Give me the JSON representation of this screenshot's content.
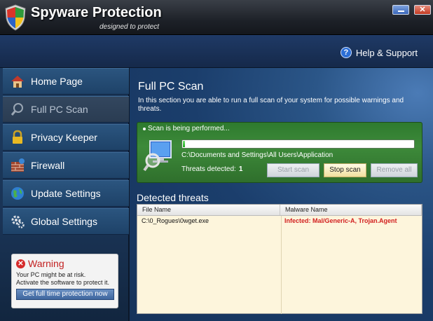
{
  "window": {
    "title": "Spyware Protection",
    "subtitle": "designed to protect"
  },
  "header": {
    "help_label": "Help & Support",
    "help_icon": "help-icon"
  },
  "sidebar": {
    "items": [
      {
        "label": "Home Page",
        "icon": "home-icon"
      },
      {
        "label": "Full PC Scan",
        "icon": "magnifier-icon",
        "active": true
      },
      {
        "label": "Privacy Keeper",
        "icon": "lock-icon"
      },
      {
        "label": "Firewall",
        "icon": "firewall-icon"
      },
      {
        "label": "Update Settings",
        "icon": "globe-icon"
      },
      {
        "label": "Global Settings",
        "icon": "gear-icon"
      }
    ],
    "warning": {
      "title": "Warning",
      "line1": "Your PC might be at risk.",
      "line2": "Activate the software to protect it.",
      "button": "Get full time protection now"
    }
  },
  "main": {
    "title": "Full PC Scan",
    "description": "In this section you are able to run a full scan of your system for possible warnings and threats.",
    "scan": {
      "status": "Scan is being performed...",
      "progress_percent": 1,
      "path": "C:\\Documents and Settings\\All Users\\Application",
      "threats_label": "Threats detected:",
      "threats_count": "1",
      "buttons": {
        "start": "Start scan",
        "stop": "Stop scan",
        "remove": "Remove all"
      }
    },
    "detected": {
      "title": "Detected threats",
      "columns": [
        "File Name",
        "Malware Name"
      ],
      "rows": [
        {
          "file": "C:\\0_Rogues\\0wget.exe",
          "malware": "Infected: Mal/Generic-A, Trojan.Agent"
        }
      ]
    }
  },
  "colors": {
    "accent": "#1f3a66",
    "scan_panel": "#3d8a3a",
    "threat_red": "#d21f1f"
  }
}
